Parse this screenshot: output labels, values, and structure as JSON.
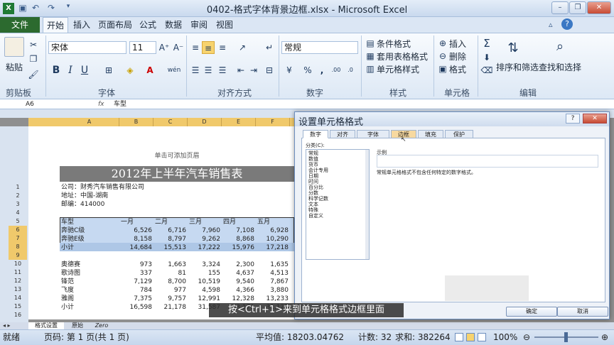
{
  "window": {
    "title": "0402-格式字体背景边框.xlsx - Microsoft Excel",
    "minimize": "–",
    "restore": "❐",
    "close": "✕"
  },
  "menu": {
    "file": "文件",
    "tabs": [
      "开始",
      "插入",
      "页面布局",
      "公式",
      "数据",
      "审阅",
      "视图"
    ],
    "active_tab": "开始"
  },
  "ribbon": {
    "clipboard": {
      "paste": "粘贴",
      "label": "剪贴板"
    },
    "font": {
      "name": "宋体",
      "size": "11",
      "bold": "B",
      "italic": "I",
      "underline": "U",
      "label": "字体",
      "grow": "A⁺",
      "shrink": "A⁻",
      "wen": "wén"
    },
    "alignment": {
      "label": "对齐方式"
    },
    "number": {
      "format": "常规",
      "percent": "%",
      "comma": ",",
      "label": "数字",
      "inc": ".00",
      "dec": ".0"
    },
    "styles": {
      "cond": "条件格式",
      "table": "套用表格格式",
      "cell": "单元格样式",
      "label": "样式"
    },
    "cells": {
      "insert": "插入",
      "delete": "删除",
      "format": "格式",
      "label": "单元格"
    },
    "editing": {
      "sort": "排序和筛选",
      "find": "查找和选择",
      "label": "编辑"
    }
  },
  "formula_bar": {
    "cell_ref": "A6",
    "fx": "fx",
    "content": "车型"
  },
  "sheet": {
    "columns": [
      "A",
      "B",
      "C",
      "D",
      "E",
      "F"
    ],
    "rows": [
      "1",
      "2",
      "3",
      "4",
      "5",
      "6",
      "7",
      "8",
      "9",
      "10",
      "11",
      "12",
      "13",
      "14",
      "15",
      "16"
    ],
    "header_hint": "单击可添加页眉",
    "title": "2012年上半年汽车销售表",
    "info": [
      "公司：财秀汽车销售有限公司",
      "地址：中国-湖南",
      "邮编：414000"
    ],
    "header_row": [
      "车型",
      "一月",
      "二月",
      "三月",
      "四月",
      "五月"
    ],
    "data_rows": [
      [
        "奔驰C级",
        "6,526",
        "6,716",
        "7,960",
        "7,108",
        "6,928"
      ],
      [
        "奔驰E级",
        "8,158",
        "8,797",
        "9,262",
        "8,868",
        "10,290"
      ],
      [
        "小计",
        "14,684",
        "15,513",
        "17,222",
        "15,976",
        "17,218"
      ],
      [
        "",
        "",
        "",
        "",
        "",
        ""
      ],
      [
        "奥德赛",
        "973",
        "1,663",
        "3,324",
        "2,300",
        "1,635"
      ],
      [
        "歌诗图",
        "337",
        "81",
        "155",
        "4,637",
        "4,513"
      ],
      [
        "锋范",
        "7,129",
        "8,700",
        "10,519",
        "9,540",
        "7,867"
      ],
      [
        "飞度",
        "784",
        "977",
        "4,598",
        "4,366",
        "3,880"
      ],
      [
        "雅阁",
        "7,375",
        "9,757",
        "12,991",
        "12,328",
        "13,233"
      ],
      [
        "小计",
        "16,598",
        "21,178",
        "31,587",
        "33,171",
        "31,128"
      ]
    ],
    "sheet_tabs": [
      "格式设置",
      "原始",
      "Zero"
    ]
  },
  "dialog": {
    "title": "设置单元格格式",
    "help": "?",
    "close": "✕",
    "tabs": [
      "数字",
      "对齐",
      "字体",
      "边框",
      "填充",
      "保护"
    ],
    "active_tab": "数字",
    "category_label": "分类(C):",
    "categories": [
      "常规",
      "数值",
      "货币",
      "会计专用",
      "日期",
      "时间",
      "百分比",
      "分数",
      "科学记数",
      "文本",
      "特殊",
      "自定义"
    ],
    "sample_label": "示例",
    "description": "常规单元格格式不包含任何特定的数字格式。",
    "ok": "确定",
    "cancel": "取消"
  },
  "caption": "按<Ctrl+1>来到单元格格式边框里面",
  "status": {
    "ready": "就绪",
    "page": "页码: 第 1 页(共 1 页)",
    "average": "平均值: 18203.04762",
    "count": "计数: 32",
    "sum": "求和: 382264",
    "zoom": "100%"
  }
}
